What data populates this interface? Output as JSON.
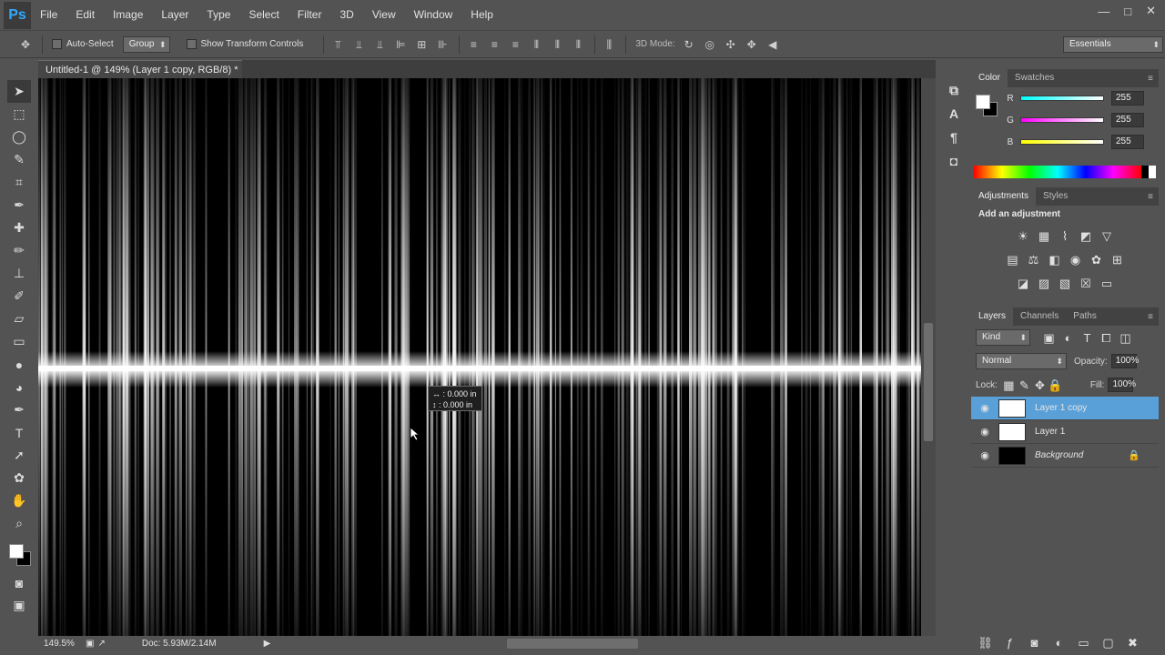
{
  "app": {
    "logo": "Ps"
  },
  "menu": [
    "File",
    "Edit",
    "Image",
    "Layer",
    "Type",
    "Select",
    "Filter",
    "3D",
    "View",
    "Window",
    "Help"
  ],
  "window_controls": {
    "minimize": "—",
    "maximize": "□",
    "close": "✕"
  },
  "options_bar": {
    "auto_select_label": "Auto-Select",
    "auto_select_target": "Group",
    "transform_controls_label": "Show Transform Controls",
    "mode_3d_label": "3D Mode:",
    "workspace": "Essentials"
  },
  "document": {
    "tab_title": "Untitled-1 @ 149% (Layer 1 copy, RGB/8) *",
    "zoom": "149.5%",
    "doc_info": "Doc: 5.93M/2.14M",
    "tooltip": {
      "line1": "↔ :  0.000 in",
      "line2": "↕ :  0.000 in"
    }
  },
  "color_panel": {
    "tabs": [
      "Color",
      "Swatches"
    ],
    "r_label": "R",
    "g_label": "G",
    "b_label": "B",
    "r": "255",
    "g": "255",
    "b": "255"
  },
  "adjustments_panel": {
    "tabs": [
      "Adjustments",
      "Styles"
    ],
    "heading": "Add an adjustment"
  },
  "layers_panel": {
    "tabs": [
      "Layers",
      "Channels",
      "Paths"
    ],
    "filter_kind": "Kind",
    "blend_mode": "Normal",
    "opacity_label": "Opacity:",
    "opacity": "100%",
    "lock_label": "Lock:",
    "fill_label": "Fill:",
    "fill": "100%",
    "layers": [
      {
        "name": "Layer 1 copy",
        "selected": true
      },
      {
        "name": "Layer 1",
        "selected": false
      },
      {
        "name": "Background",
        "selected": false
      }
    ]
  },
  "colors": {
    "accent_select": "#5aa0d8",
    "ps_blue": "#31a8ff"
  }
}
